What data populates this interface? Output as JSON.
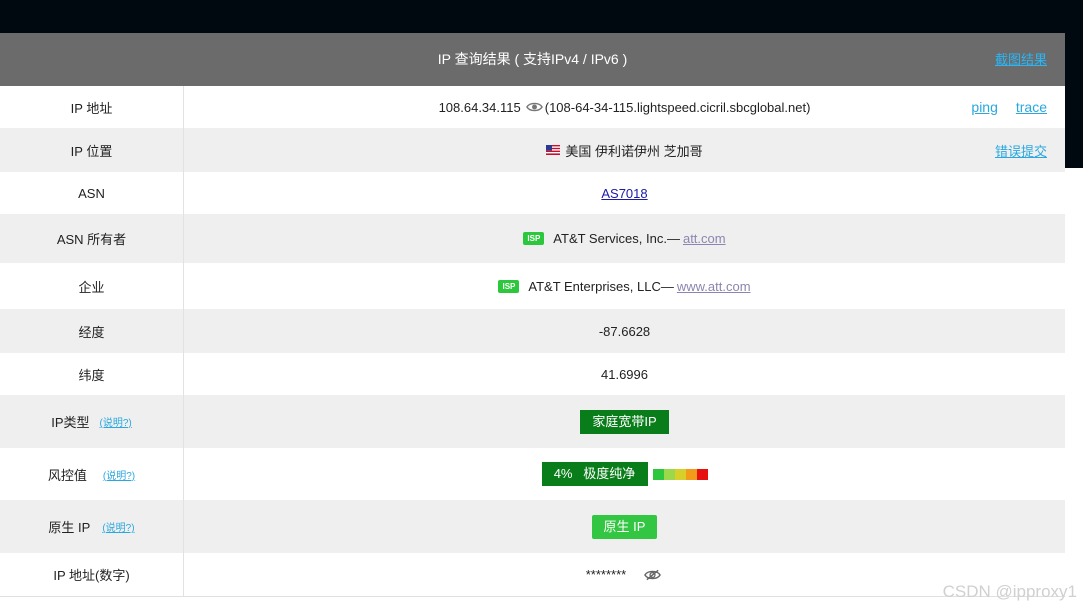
{
  "header": {
    "title": "IP 查询结果 ( 支持IPv4 / IPv6 )",
    "screenshot_link": "截图结果"
  },
  "rows": {
    "ip": {
      "label": "IP 地址",
      "value": "108.64.34.115",
      "hostname": "(108-64-34-115.lightspeed.cicril.sbcglobal.net)",
      "ping": "ping",
      "trace": "trace"
    },
    "location": {
      "label": "IP 位置",
      "flag_icon": "us-flag-icon",
      "value": "美国 伊利诺伊州 芝加哥",
      "report": "错误提交"
    },
    "asn": {
      "label": "ASN",
      "value": "AS7018"
    },
    "asn_owner": {
      "label": "ASN 所有者",
      "badge": "ISP",
      "value": "AT&T Services, Inc.—",
      "domain": "att.com"
    },
    "company": {
      "label": "企业",
      "badge": "ISP",
      "value": "AT&T Enterprises, LLC—",
      "domain": "www.att.com"
    },
    "longitude": {
      "label": "经度",
      "value": "-87.6628"
    },
    "latitude": {
      "label": "纬度",
      "value": "41.6996"
    },
    "ip_type": {
      "label": "IP类型",
      "help": "(说明?)",
      "value": "家庭宽带IP"
    },
    "risk": {
      "label": "风控值",
      "help": "(说明?)",
      "value": "4%   极度纯净",
      "scale_colors": [
        "#2dc73d",
        "#9bd84a",
        "#d8d02a",
        "#f39a1b",
        "#e8100f"
      ]
    },
    "native": {
      "label": "原生 IP",
      "help": "(说明?)",
      "value": "原生 IP"
    },
    "ip_numeric": {
      "label": "IP 地址(数字)",
      "value": "********"
    }
  },
  "watermark": "CSDN @ipproxy1",
  "colors": {
    "header_bg": "#6b6b6b",
    "link": "#29a8e0",
    "green_dark": "#0a7d1b",
    "green_light": "#33c642"
  }
}
